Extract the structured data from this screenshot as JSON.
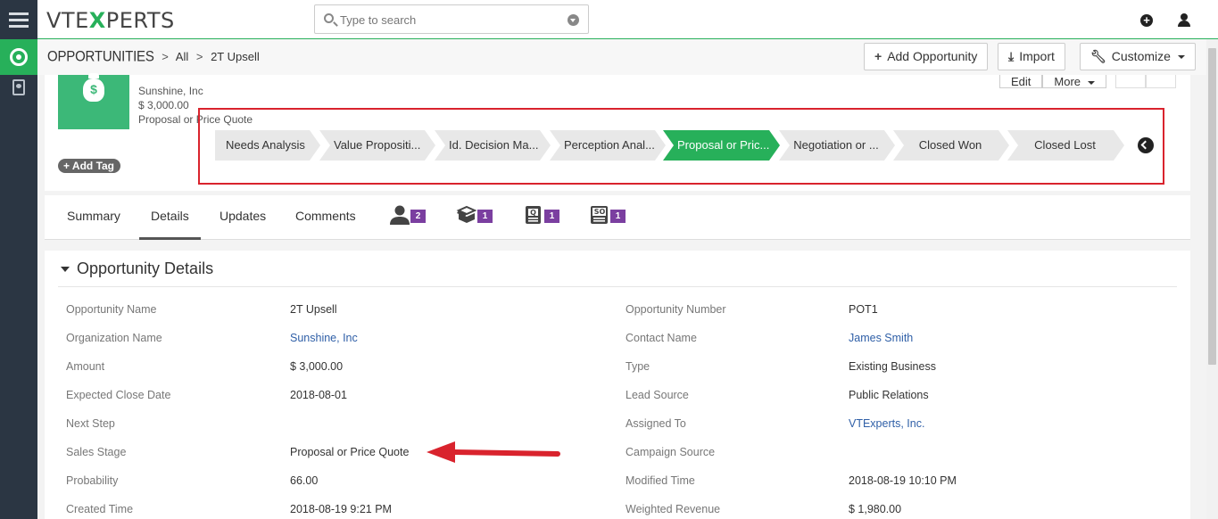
{
  "app": {
    "logo_pre": "VTE",
    "logo_x": "X",
    "logo_post": "PERTS",
    "search_placeholder": "Type to search"
  },
  "breadcrumb": {
    "module": "OPPORTUNITIES",
    "filter": "All",
    "record": "2T Upsell"
  },
  "header_buttons": {
    "add": "Add Opportunity",
    "import": "Import",
    "customize": "Customize"
  },
  "record": {
    "organization": "Sunshine, Inc",
    "amount": "$ 3,000.00",
    "stage": "Proposal or Price Quote",
    "edit_label": "Edit",
    "more_label": "More",
    "add_tag": "Add Tag"
  },
  "stages": [
    {
      "label": "Needs Analysis",
      "active": false
    },
    {
      "label": "Value Propositi...",
      "active": false
    },
    {
      "label": "Id. Decision Ma...",
      "active": false
    },
    {
      "label": "Perception Anal...",
      "active": false
    },
    {
      "label": "Proposal or Pric...",
      "active": true
    },
    {
      "label": "Negotiation or ...",
      "active": false
    },
    {
      "label": "Closed Won",
      "active": false
    },
    {
      "label": "Closed Lost",
      "active": false
    }
  ],
  "tabs": {
    "summary": "Summary",
    "details": "Details",
    "updates": "Updates",
    "comments": "Comments",
    "contacts_count": "2",
    "products_count": "1",
    "quotes_count": "1",
    "sales_orders_count": "1",
    "sales_order_abbr": "SO"
  },
  "section": {
    "title": "Opportunity Details"
  },
  "fields_left": [
    {
      "label": "Opportunity Name",
      "value": "2T Upsell",
      "link": false
    },
    {
      "label": "Organization Name",
      "value": "Sunshine, Inc",
      "link": true
    },
    {
      "label": "Amount",
      "value": "$ 3,000.00",
      "link": false
    },
    {
      "label": "Expected Close Date",
      "value": "2018-08-01",
      "link": false
    },
    {
      "label": "Next Step",
      "value": "",
      "link": false
    },
    {
      "label": "Sales Stage",
      "value": "Proposal or Price Quote",
      "link": false
    },
    {
      "label": "Probability",
      "value": "66.00",
      "link": false
    },
    {
      "label": "Created Time",
      "value": "2018-08-19 9:21 PM",
      "link": false
    }
  ],
  "fields_right": [
    {
      "label": "Opportunity Number",
      "value": "POT1",
      "link": false
    },
    {
      "label": "Contact Name",
      "value": "James Smith",
      "link": true
    },
    {
      "label": "Type",
      "value": "Existing Business",
      "link": false
    },
    {
      "label": "Lead Source",
      "value": "Public Relations",
      "link": false
    },
    {
      "label": "Assigned To",
      "value": "VTExperts, Inc.",
      "link": true
    },
    {
      "label": "Campaign Source",
      "value": "",
      "link": false
    },
    {
      "label": "Modified Time",
      "value": "2018-08-19 10:10 PM",
      "link": false
    },
    {
      "label": "Weighted Revenue",
      "value": "$ 1,980.00",
      "link": false
    }
  ],
  "colors": {
    "brand_green": "#27b05a",
    "annotation_red": "#d9232d",
    "badge_purple": "#7b3fa0",
    "link_blue": "#2f5fa7"
  }
}
